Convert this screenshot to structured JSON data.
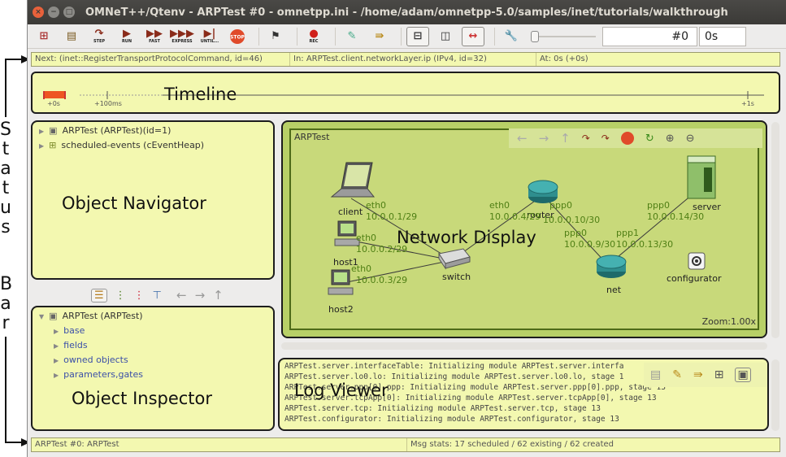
{
  "window": {
    "title": "OMNeT++/Qtenv - ARPTest #0 - omnetpp.ini - /home/adam/omnetpp-5.0/samples/inet/tutorials/walkthrough"
  },
  "toolbar": {
    "step": "STEP",
    "run": "RUN",
    "fast": "FAST",
    "express": "EXPRESS",
    "until": "UNTIL...",
    "stop": "STOP",
    "rec": "REC",
    "event_number": "#0",
    "sim_time": "0s"
  },
  "status": {
    "next": "Next: (inet::RegisterTransportProtocolCommand, id=46)",
    "in": "In: ARPTest.client.networkLayer.ip (IPv4, id=32)",
    "at": "At: 0s (+0s)"
  },
  "timeline": {
    "label": "Timeline",
    "tick_0": "+0s",
    "tick_100": "+100ms",
    "tick_1": "+1s"
  },
  "navigator": {
    "label": "Object Navigator",
    "items": [
      "ARPTest (ARPTest)(id=1)",
      "scheduled-events (cEventHeap)"
    ]
  },
  "inspector": {
    "label": "Object Inspector",
    "root": "ARPTest (ARPTest)",
    "children": [
      "base",
      "fields",
      "owned objects",
      "parameters,gates"
    ]
  },
  "network": {
    "label": "Network Display",
    "title": "ARPTest",
    "zoom": "Zoom:1.00x",
    "nodes": {
      "client": "client",
      "host1": "host1",
      "host2": "host2",
      "switch": "switch",
      "router": "router",
      "net": "net",
      "server": "server",
      "configurator": "configurator"
    },
    "ifaces": {
      "client_eth0": "eth0",
      "client_ip": "10.0.0.1/29",
      "host1_eth0": "eth0",
      "host1_ip": "10.0.0.2/29",
      "host2_eth0": "eth0",
      "host2_ip": "10.0.0.3/29",
      "router_eth0": "eth0",
      "router_eth0_ip": "10.0.0.4/29",
      "router_ppp0": "ppp0",
      "router_ppp0_ip": "10.0.0.10/30",
      "net_ppp0": "ppp0",
      "net_ppp0_ip": "10.0.0.9/30",
      "net_ppp1": "ppp1",
      "net_ppp1_ip": "10.0.0.13/30",
      "server_ppp0": "ppp0",
      "server_ip": "10.0.0.14/30"
    }
  },
  "log": {
    "label": "Log Viewer",
    "lines": [
      "ARPTest.server.interfaceTable: Initializing module ARPTest.server.interfa",
      "ARPTest.server.lo0.lo: Initializing module ARPTest.server.lo0.lo, stage 1",
      "ARPTest.server.ppp[0].ppp: Initializing module ARPTest.server.ppp[0].ppp, stage 13",
      "ARPTest.server.tcpApp[0]: Initializing module ARPTest.server.tcpApp[0], stage 13",
      "ARPTest.server.tcp: Initializing module ARPTest.server.tcp, stage 13",
      "ARPTest.configurator: Initializing module ARPTest.configurator, stage 13"
    ]
  },
  "bottom": {
    "left": "ARPTest #0: ARPTest",
    "right": "Msg stats: 17 scheduled / 62 existing / 62 created"
  },
  "annotation": {
    "status_bar_letters": [
      "S",
      "t",
      "a",
      "t",
      "u",
      "s",
      "B",
      "a",
      "r"
    ]
  },
  "colors": {
    "panel": "#f3f8b0",
    "network_bg": "#c8d97a",
    "link": "#3b3b3b",
    "label_green": "#4f7f14"
  }
}
